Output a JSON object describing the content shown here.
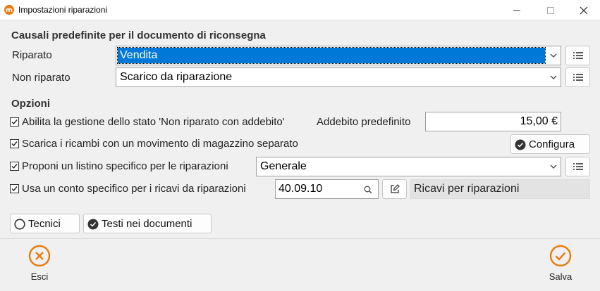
{
  "window": {
    "title": "Impostazioni riparazioni"
  },
  "causali": {
    "header": "Causali predefinite per il documento di riconsegna",
    "riparato": {
      "label": "Riparato",
      "value": "Vendita"
    },
    "non_riparato": {
      "label": "Non riparato",
      "value": "Scarico da riparazione"
    }
  },
  "opzioni": {
    "header": "Opzioni",
    "abilita": {
      "label": "Abilita la gestione dello stato 'Non riparato con addebito'",
      "checked": true
    },
    "addebito": {
      "label": "Addebito predefinito",
      "value": "15,00 €"
    },
    "scarica": {
      "label": "Scarica i ricambi con un movimento di magazzino separato",
      "checked": true
    },
    "configura": {
      "label": "Configura"
    },
    "listino": {
      "label": "Proponi un listino specifico per le riparazioni",
      "checked": true,
      "value": "Generale"
    },
    "conto": {
      "label": "Usa un conto specifico per i ricavi da riparazioni",
      "checked": true,
      "code": "40.09.10",
      "description": "Ricavi per riparazioni"
    }
  },
  "buttons": {
    "tecnici": "Tecnici",
    "testi": "Testi nei documenti",
    "esci": "Esci",
    "salva": "Salva"
  },
  "colors": {
    "accent": "#e87b0c",
    "selection": "#0078d7"
  }
}
